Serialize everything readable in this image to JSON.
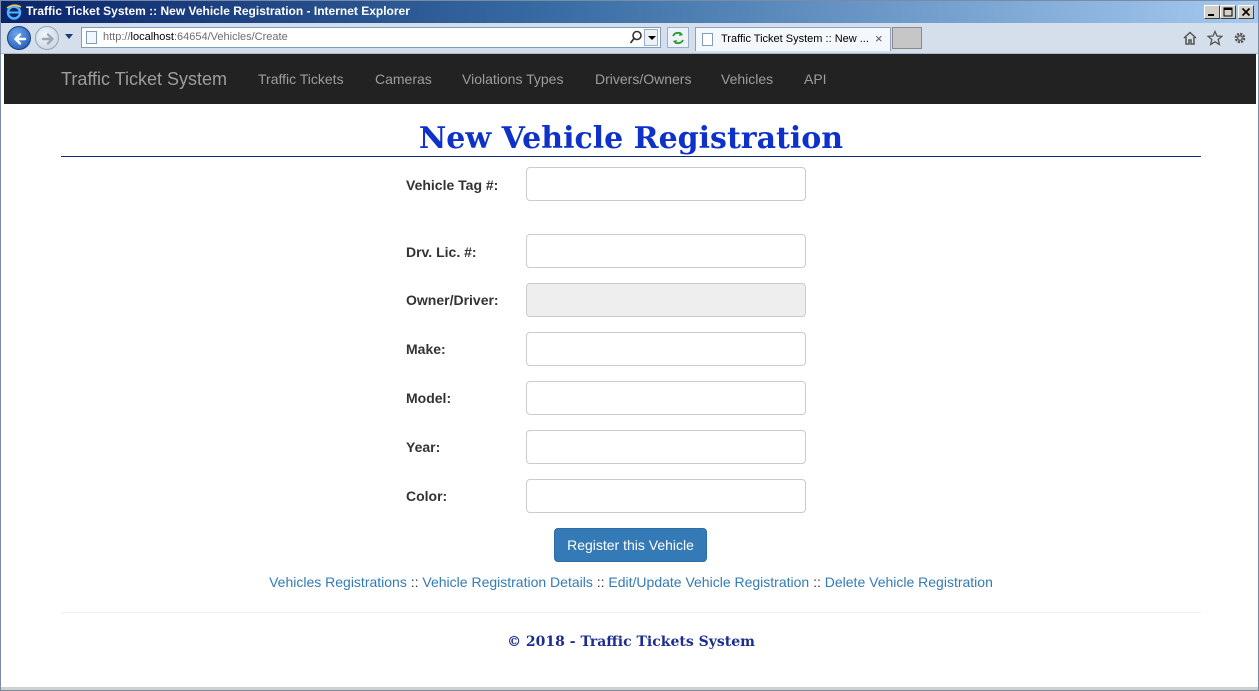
{
  "window": {
    "title": "Traffic Ticket System :: New Vehicle Registration - Internet Explorer"
  },
  "browser": {
    "url_prefix": "http://",
    "url_host": "localhost",
    "url_rest": ":64654/Vehicles/Create",
    "tab_title": "Traffic Ticket System :: New ...",
    "tab_close": "×"
  },
  "navbar": {
    "brand": "Traffic Ticket System",
    "links": [
      "Traffic Tickets",
      "Cameras",
      "Violations Types",
      "Drivers/Owners",
      "Vehicles",
      "API"
    ]
  },
  "page": {
    "title": "New Vehicle Registration"
  },
  "form": {
    "fields": [
      {
        "label": "Vehicle Tag #:",
        "value": "",
        "disabled": false
      },
      {
        "label": "Drv. Lic. #:",
        "value": "",
        "disabled": false
      },
      {
        "label": "Owner/Driver:",
        "value": "",
        "disabled": true
      },
      {
        "label": "Make:",
        "value": "",
        "disabled": false
      },
      {
        "label": "Model:",
        "value": "",
        "disabled": false
      },
      {
        "label": "Year:",
        "value": "",
        "disabled": false
      },
      {
        "label": "Color:",
        "value": "",
        "disabled": false
      }
    ],
    "submit_label": "Register this Vehicle"
  },
  "links": {
    "separator": " :: ",
    "items": [
      "Vehicles Registrations",
      "Vehicle Registration Details",
      "Edit/Update Vehicle Registration",
      "Delete Vehicle Registration"
    ]
  },
  "footer": {
    "text": "© 2018 - Traffic Tickets System"
  },
  "colors": {
    "title_blue": "#0e31c9",
    "navbar_bg": "#222222",
    "button_blue": "#337ab7",
    "link_blue": "#337ab7"
  },
  "icons": [
    "ie-logo-icon",
    "back-arrow-icon",
    "forward-arrow-icon",
    "search-icon",
    "refresh-icon",
    "home-icon",
    "favorites-star-icon",
    "gear-icon"
  ]
}
